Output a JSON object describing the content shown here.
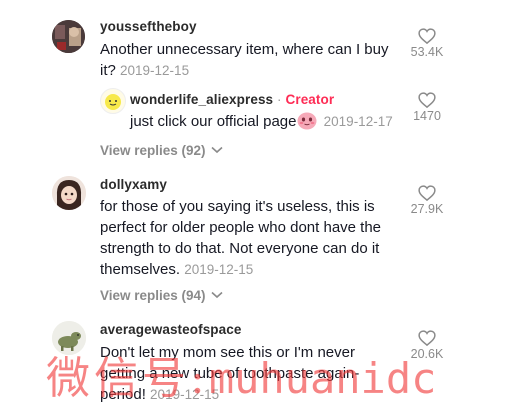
{
  "comments": [
    {
      "username": "yousseftheboy",
      "text_lines": [
        "Another unnecessary item, where can I buy",
        "it?"
      ],
      "date": "2019-12-15",
      "likes": "53.4K",
      "reply": {
        "username": "wonderlife_aliexpress",
        "separator": "·",
        "badge": "Creator",
        "text": "just click our official page",
        "date": "2019-12-17",
        "likes": "1470"
      },
      "view_replies": "View replies (92)"
    },
    {
      "username": "dollyxamy",
      "text_lines": [
        "for those of you saying it's useless, this is",
        "perfect for older people who dont have the",
        "strength to do that. Not everyone can do it",
        "themselves."
      ],
      "date": "2019-12-15",
      "likes": "27.9K",
      "view_replies": "View replies (94)"
    },
    {
      "username": "averagewasteofspace",
      "text_lines": [
        "Don't let my mom see this or I'm never",
        "getting a new tube of toothpaste again-",
        "period!"
      ],
      "date": "2019-12-15",
      "likes": "20.6K"
    }
  ],
  "watermark": {
    "cjk": "微信号:",
    "latin": "muhuanidc"
  },
  "colors": {
    "creator_badge": "#fe2c55",
    "date": "#9a9a9a",
    "watermark": "#f23a3a"
  }
}
